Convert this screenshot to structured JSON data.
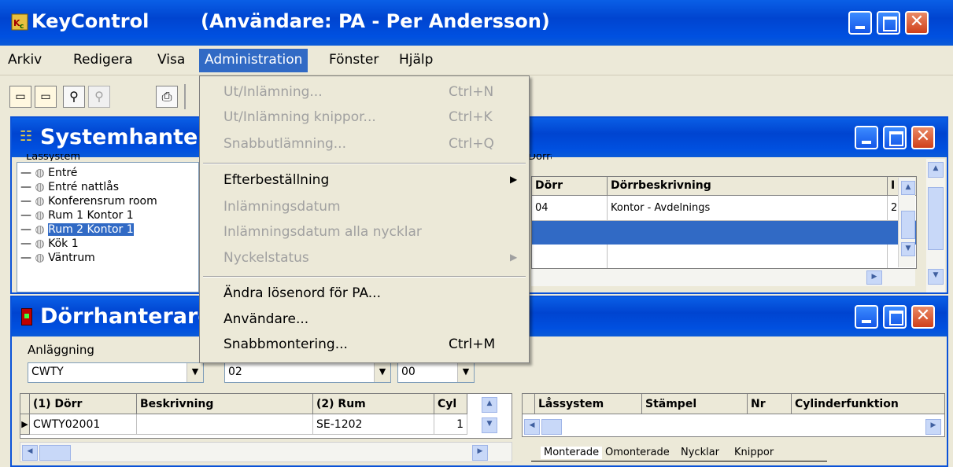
{
  "app": {
    "title": "KeyControl",
    "user_label": "(Användare: PA - Per Andersson)"
  },
  "menubar": [
    "Arkiv",
    "Redigera",
    "Visa",
    "Administration",
    "Fönster",
    "Hjälp"
  ],
  "admin_menu": {
    "items": [
      {
        "label": "Ut/Inlämning...",
        "shortcut": "Ctrl+N",
        "enabled": false
      },
      {
        "label": "Ut/Inlämning knippor...",
        "shortcut": "Ctrl+K",
        "enabled": false
      },
      {
        "label": "Snabbutlämning...",
        "shortcut": "Ctrl+Q",
        "enabled": false
      },
      {
        "label": "Efterbeställning",
        "shortcut": "",
        "enabled": true,
        "submenu": true
      },
      {
        "label": "Inlämningsdatum",
        "shortcut": "",
        "enabled": false
      },
      {
        "label": "Inlämningsdatum alla nycklar",
        "shortcut": "",
        "enabled": false
      },
      {
        "label": "Nyckelstatus",
        "shortcut": "",
        "enabled": false,
        "submenu": true
      },
      {
        "label": "Ändra lösenord för PA...",
        "shortcut": "",
        "enabled": true
      },
      {
        "label": "Användare...",
        "shortcut": "",
        "enabled": true
      },
      {
        "label": "Snabbmontering...",
        "shortcut": "Ctrl+M",
        "enabled": true
      }
    ]
  },
  "system_window": {
    "title": "Systemhanter",
    "group_label": "Låssystem",
    "tree": [
      "Entré",
      "Entré nattlås",
      "Konferensrum room",
      "Rum 1 Kontor 1",
      "Rum 2 Kontor 1",
      "Kök 1",
      "Väntrum"
    ],
    "selected_index": 4,
    "right_group_label": "Dörrar",
    "right_headers": [
      "Dörr",
      "Dörrbeskrivning",
      "I"
    ],
    "right_rows": [
      [
        "04",
        "Kontor  - Avdelnings",
        "2"
      ],
      [
        "",
        "",
        ""
      ],
      [
        "",
        "",
        ""
      ]
    ]
  },
  "door_window": {
    "title": "Dörrhanterare",
    "anlaggning_label": "Anläggning",
    "combos": [
      "CWTY",
      "02",
      "00"
    ],
    "left_headers": [
      "(1) Dörr",
      "Beskrivning",
      "(2) Rum",
      "Cyl"
    ],
    "left_rows": [
      [
        "CWTY02001",
        "",
        "SE-1202",
        "1"
      ]
    ],
    "right_headers": [
      "Låssystem",
      "Stämpel",
      "Nr",
      "Cylinderfunktion"
    ],
    "tabs": [
      "Monterade",
      "Omonterade",
      "Nycklar",
      "Knippor"
    ]
  },
  "colors": {
    "title_active": "#0050e0",
    "highlight": "#316ac5",
    "face": "#ece9d8"
  }
}
